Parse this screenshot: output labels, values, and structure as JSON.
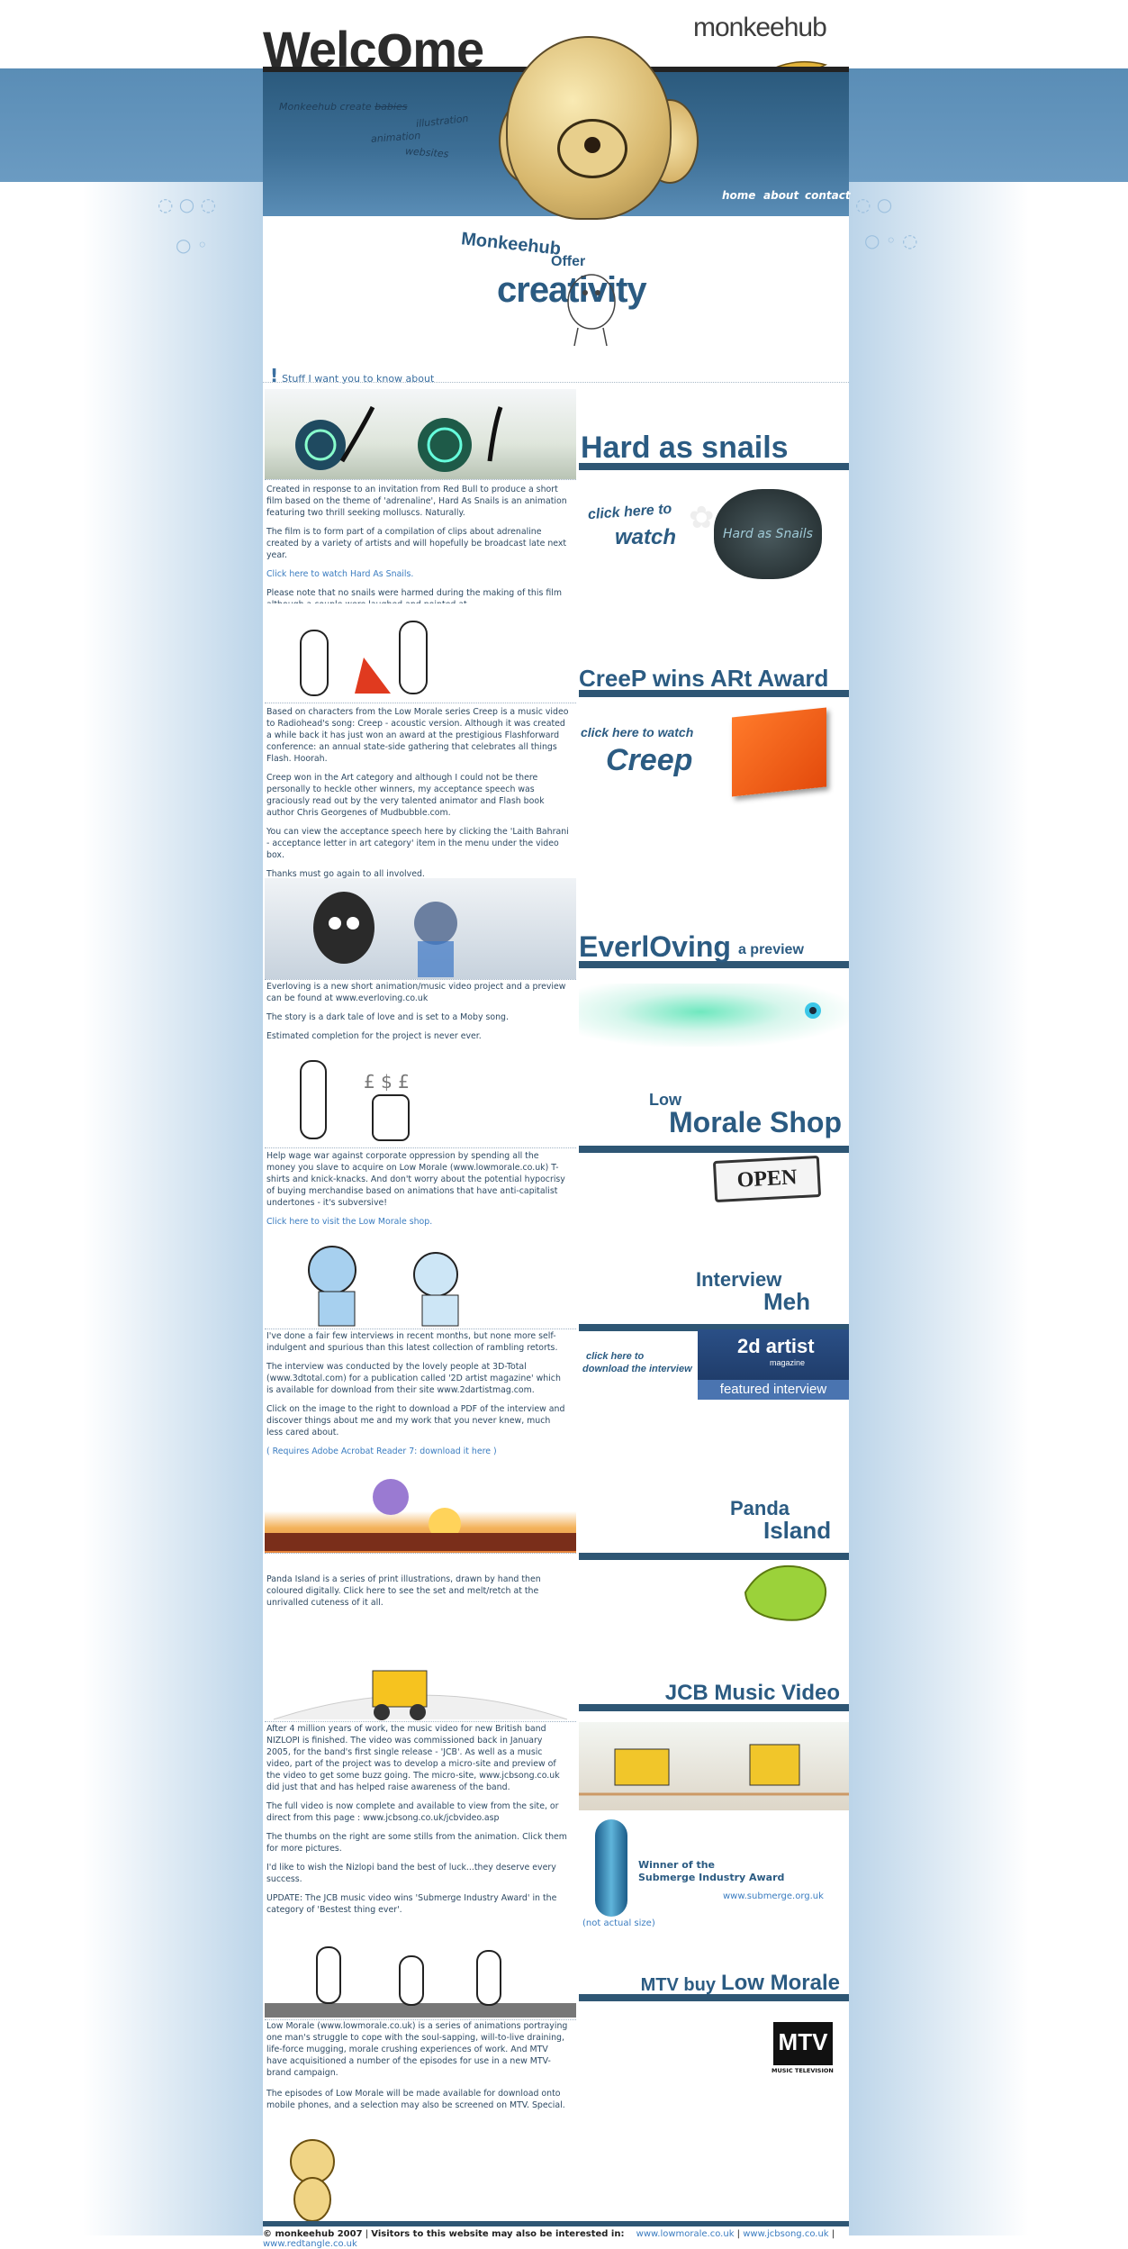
{
  "header": {
    "title_parts": [
      "Welc",
      "o",
      "me"
    ],
    "brand": "monkeehub",
    "tag_lines": {
      "create_prefix": "Monkeehub  create",
      "struck": "babies",
      "items": [
        "illustration",
        "animation",
        "websites"
      ]
    },
    "nav": [
      "home",
      "about",
      "contact"
    ]
  },
  "banner": {
    "line1": "Monkeehub",
    "line2": "Offer",
    "line3": "creativity"
  },
  "intro_label": "Stuff I want you to know about",
  "sections": [
    {
      "heading": [
        "Hard as snails"
      ],
      "paragraphs": [
        "Created in response to an invitation from Red Bull to produce a short film based on the theme of 'adrenaline', Hard As Snails is an animation featuring two thrill seeking molluscs. Naturally.",
        "The film is to form part of a compilation of clips about adrenaline created by a variety of artists and will hopefully be broadcast late next year.",
        "Click here to watch Hard As Snails.",
        "Please note that no snails were harmed during the making of this film although a couple were laughed and pointed at."
      ],
      "cta": [
        "click here to",
        "watch"
      ],
      "card_label": "Hard as Snails"
    },
    {
      "heading": [
        "CreeP wins ARt Award"
      ],
      "paragraphs": [
        "Based on characters from the Low Morale series Creep is a music video to Radiohead's song: Creep - acoustic version. Although it was created a while back it has just won an award at the prestigious Flashforward conference: an annual state-side gathering that celebrates all things Flash. Hoorah.",
        "Creep won in the Art category and although I could not be there personally to heckle other winners, my acceptance speech was graciously read out by the very talented animator and Flash book author Chris Georgenes of Mudbubble.com.",
        "You can view the acceptance speech here by clicking the 'Laith Bahrani - acceptance letter in art category' item in the menu under the video box.",
        "Thanks must go again to all involved."
      ],
      "cta": [
        "click here to watch",
        "Creep"
      ]
    },
    {
      "heading": [
        "EverlOving",
        "a preview"
      ],
      "paragraphs": [
        "Everloving is a new short animation/music video project and a preview can be found at www.everloving.co.uk",
        "The story is a dark tale of love and is set to a Moby song.",
        "Estimated completion for the project is never ever."
      ]
    },
    {
      "heading": [
        "Low",
        "Morale Shop"
      ],
      "paragraphs": [
        "Help wage war against corporate oppression by spending all the money you slave to acquire on Low Morale (www.lowmorale.co.uk) T-shirts and knick-knacks. And don't worry about the potential hypocrisy of buying merchandise based on animations that have anti-capitalist undertones - it's subversive!",
        "Click here to visit the Low Morale shop."
      ],
      "sign": "OPEN"
    },
    {
      "heading": [
        "Interview",
        "Meh"
      ],
      "paragraphs": [
        "I've done a fair few interviews in recent months, but none more self-indulgent and spurious than this latest collection of rambling retorts.",
        "The interview was conducted by the lovely people at 3D-Total (www.3dtotal.com) for a publication called '2D artist magazine' which is available for download from their site www.2dartistmag.com.",
        "Click on the image to the right to download a PDF of the interview and discover things about me and my work that you never knew, much less cared about.",
        "( Requires Adobe Acrobat Reader 7: download it here )"
      ],
      "cta": [
        "click here to",
        "download the interview"
      ],
      "card_title": "2d artist",
      "card_sub": "magazine",
      "card_band": "featured interview"
    },
    {
      "heading": [
        "Panda",
        "Island"
      ],
      "paragraphs": [
        "Panda Island is a series of print illustrations, drawn by hand then coloured digitally. Click here to see the set and melt/retch at the unrivalled cuteness of it all."
      ]
    },
    {
      "heading": [
        "JCB Music Video"
      ],
      "paragraphs": [
        "After 4 million years of work, the music video for new British band NIZLOPI is finished. The video was commissioned back in January 2005, for the band's first single release - 'JCB'. As well as a music video, part of the project was to develop a micro-site and preview of the video to get some buzz going. The micro-site, www.jcbsong.co.uk did just that and has helped raise awareness of the band.",
        "The full video is now complete and available to view from the site, or direct from this page : www.jcbsong.co.uk/jcbvideo.asp",
        "The thumbs on the right are some stills from the animation. Click them for more pictures.",
        "I'd like to wish the Nizlopi band the best of luck...they deserve every success.",
        "UPDATE: The JCB music video wins 'Submerge Industry Award' in the category of 'Bestest thing ever'."
      ],
      "award_text": [
        "Winner of the",
        "Submerge Industry Award"
      ],
      "award_link": "www.submerge.org.uk",
      "award_note": "(not actual size)"
    },
    {
      "heading": [
        "MTV buy",
        "Low Morale"
      ],
      "paragraphs": [
        "Low Morale (www.lowmorale.co.uk) is a series of animations portraying one man's struggle to cope with the soul-sapping, will-to-live draining, life-force mugging, morale crushing experiences of work. And MTV have acquisitioned a number of the episodes for use in a new MTV-brand campaign.",
        "The episodes of Low Morale will be made available for download onto mobile phones, and a selection may also be screened on MTV. Special."
      ],
      "logo_text": "MTV",
      "logo_sub": "MUSIC TELEVISION"
    }
  ],
  "footer": {
    "copyright": "© monkeehub 2007",
    "visitors": "Visitors to this website may also be interested in:",
    "links": [
      "www.lowmorale.co.uk",
      "www.jcbsong.co.uk",
      "www.redtangle.co.uk"
    ]
  },
  "colors": {
    "band": "#5a8db6",
    "heading": "#2b5b82",
    "rule": "#2e5674",
    "link": "#3a7cc0"
  }
}
